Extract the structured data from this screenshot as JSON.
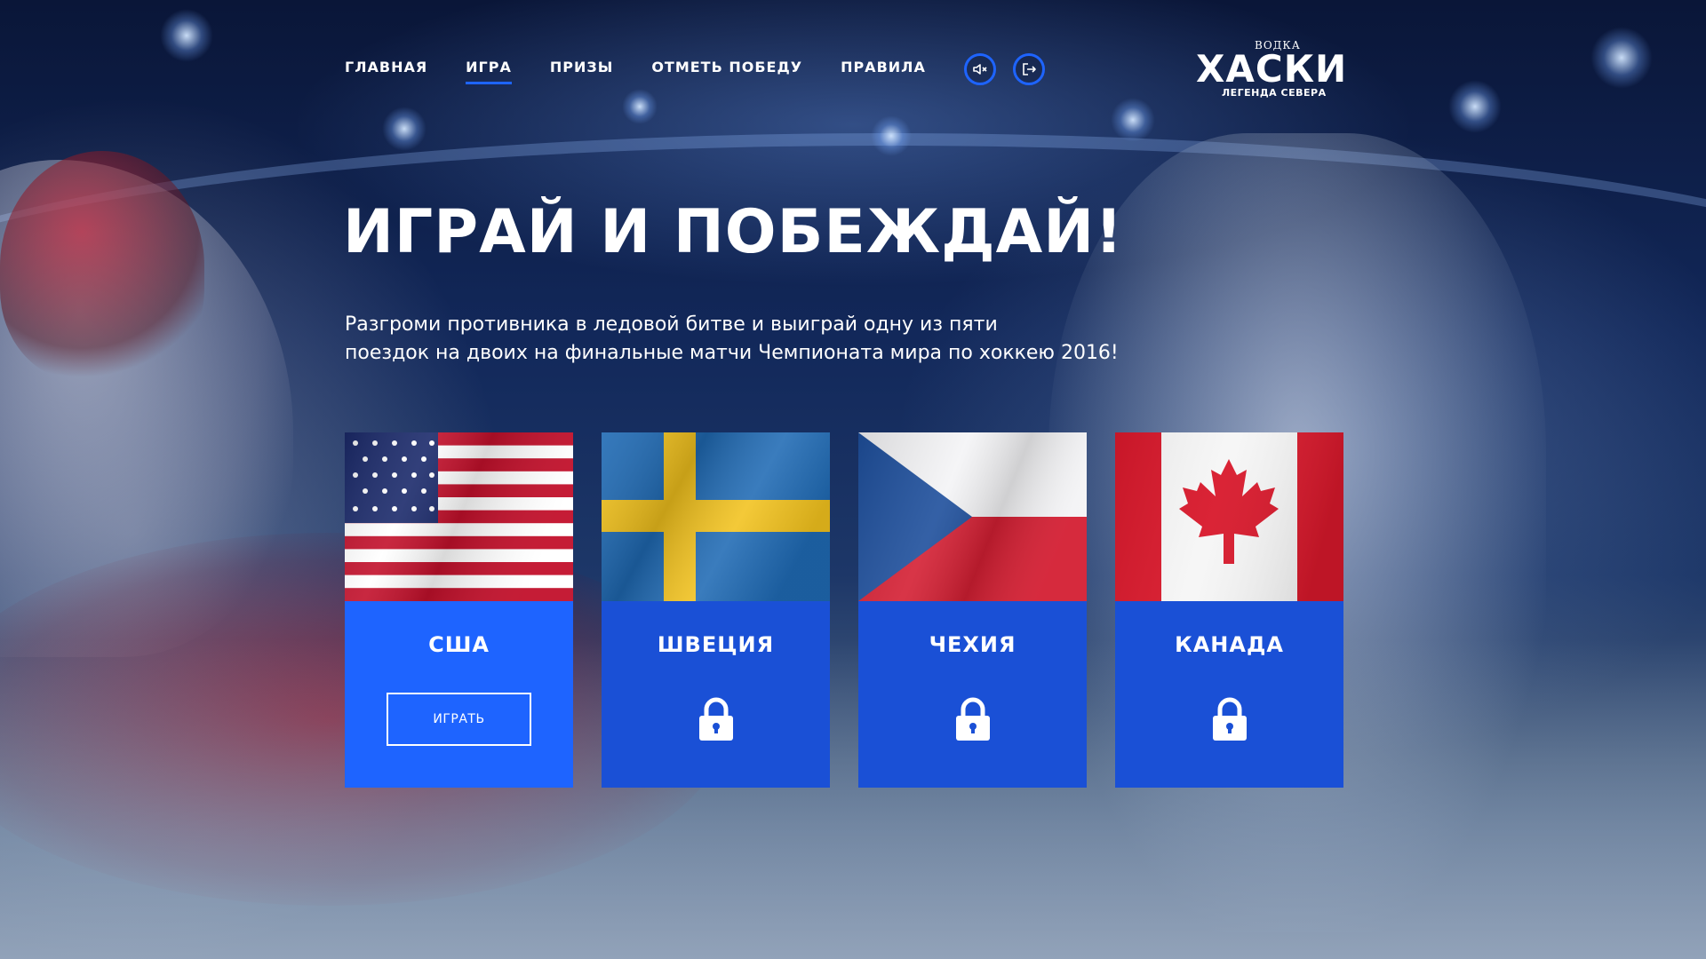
{
  "nav": {
    "items": [
      {
        "label": "ГЛАВНАЯ",
        "active": false
      },
      {
        "label": "ИГРА",
        "active": true
      },
      {
        "label": "ПРИЗЫ",
        "active": false
      },
      {
        "label": "ОТМЕТЬ ПОБЕДУ",
        "active": false
      },
      {
        "label": "ПРАВИЛА",
        "active": false
      }
    ],
    "mute_icon": "speaker-muted-icon",
    "exit_icon": "logout-icon"
  },
  "logo": {
    "top": "ВОДКА",
    "main": "ХАСКИ",
    "sub": "ЛЕГЕНДА СЕВЕРА"
  },
  "hero": {
    "headline": "ИГРАЙ И ПОБЕЖДАЙ!",
    "subtext_line1": "Разгроми противника в ледовой битве и выиграй одну из пяти",
    "subtext_line2": "поездок на двоих на финальные матчи Чемпионата мира по хоккею 2016!"
  },
  "cards": [
    {
      "country": "США",
      "state": "unlocked",
      "button_label": "ИГРАТЬ",
      "color": "#1e64ff"
    },
    {
      "country": "ШВЕЦИЯ",
      "state": "locked",
      "icon": "lock-icon",
      "color": "#1a50d6"
    },
    {
      "country": "ЧЕХИЯ",
      "state": "locked",
      "icon": "lock-icon",
      "color": "#1a50d6"
    },
    {
      "country": "КАНАДА",
      "state": "locked",
      "icon": "lock-icon",
      "color": "#1a50d6"
    }
  ],
  "colors": {
    "accent": "#1e64ff",
    "card_active": "#1e64ff",
    "card_locked": "#1a50d6"
  }
}
